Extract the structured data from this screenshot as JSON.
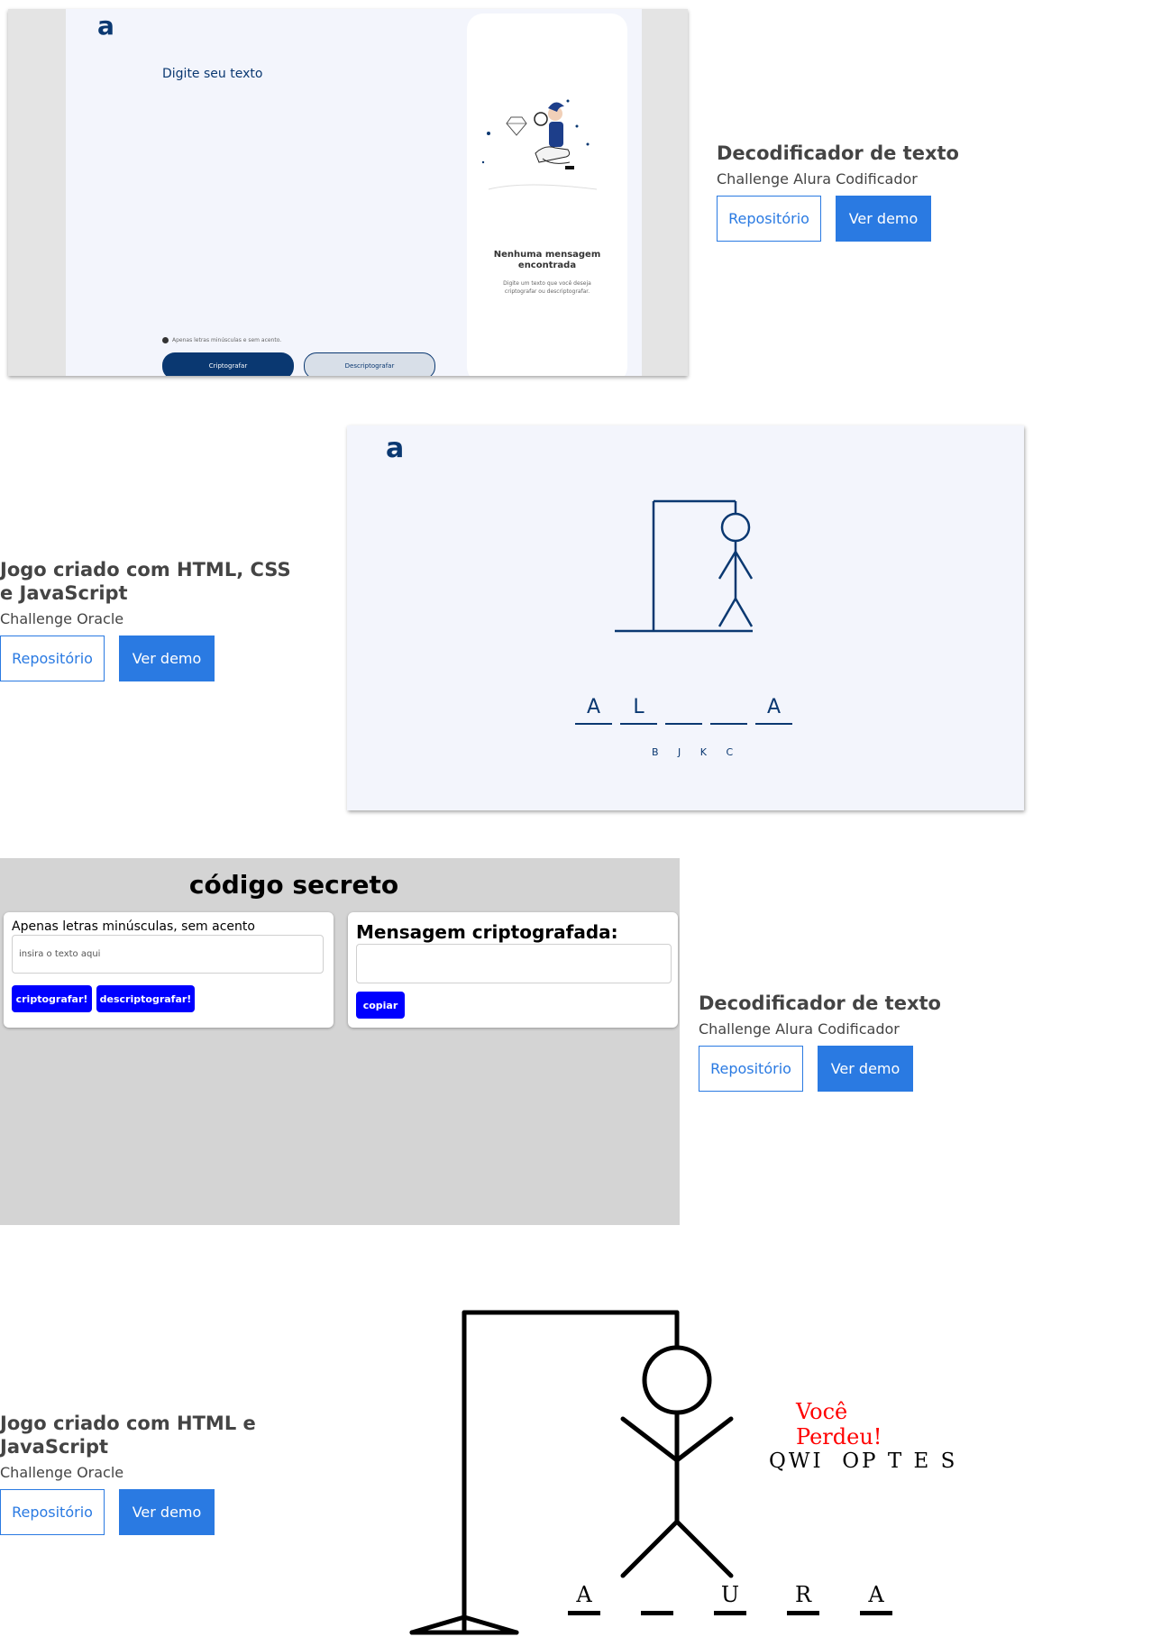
{
  "projects": [
    {
      "title": "Decodificador de texto",
      "subtitle": "Challenge Alura Codificador",
      "repo_label": "Repositório",
      "demo_label": "Ver demo",
      "preview": {
        "logo": "a",
        "prompt": "Digite seu texto",
        "hint": "Apenas letras minúsculas e sem acento.",
        "encrypt_label": "Criptografar",
        "decrypt_label": "Descriptografar",
        "empty_title": "Nenhuma mensagem encontrada",
        "empty_text": "Digite um texto que você deseja criptografar ou descriptografar."
      }
    },
    {
      "title": "Jogo criado com HTML, CSS e JavaScript",
      "subtitle": "Challenge Oracle",
      "repo_label": "Repositório",
      "demo_label": "Ver demo",
      "preview": {
        "logo": "a",
        "letters": [
          "A",
          "L",
          "",
          "",
          "A"
        ],
        "wrong_letters": "B J K C"
      }
    },
    {
      "title": "Decodificador de texto",
      "subtitle": "Challenge Alura Codificador",
      "repo_label": "Repositório",
      "demo_label": "Ver demo",
      "preview": {
        "heading": "código secreto",
        "input_label": "Apenas letras minúsculas, sem acento",
        "input_placeholder": "insira o texto aqui",
        "encrypt_label": "criptografar!",
        "decrypt_label": "descriptografar!",
        "output_heading": "Mensagem criptografada:",
        "copy_label": "copiar"
      }
    },
    {
      "title": "Jogo criado com HTML e JavaScript",
      "subtitle": "Challenge Oracle",
      "repo_label": "Repositório",
      "demo_label": "Ver demo",
      "preview": {
        "status": "Você Perdeu!",
        "wrong_letters": "QWI  OP T E S",
        "letters": [
          "A",
          "",
          "U",
          "R",
          "A"
        ]
      }
    }
  ],
  "colors": {
    "accent": "#2a7ae2",
    "alura_blue": "#0a3871",
    "preview_bg": "#f3f5fc",
    "game_button": "#0000ff",
    "lost_red": "#ff0000"
  }
}
